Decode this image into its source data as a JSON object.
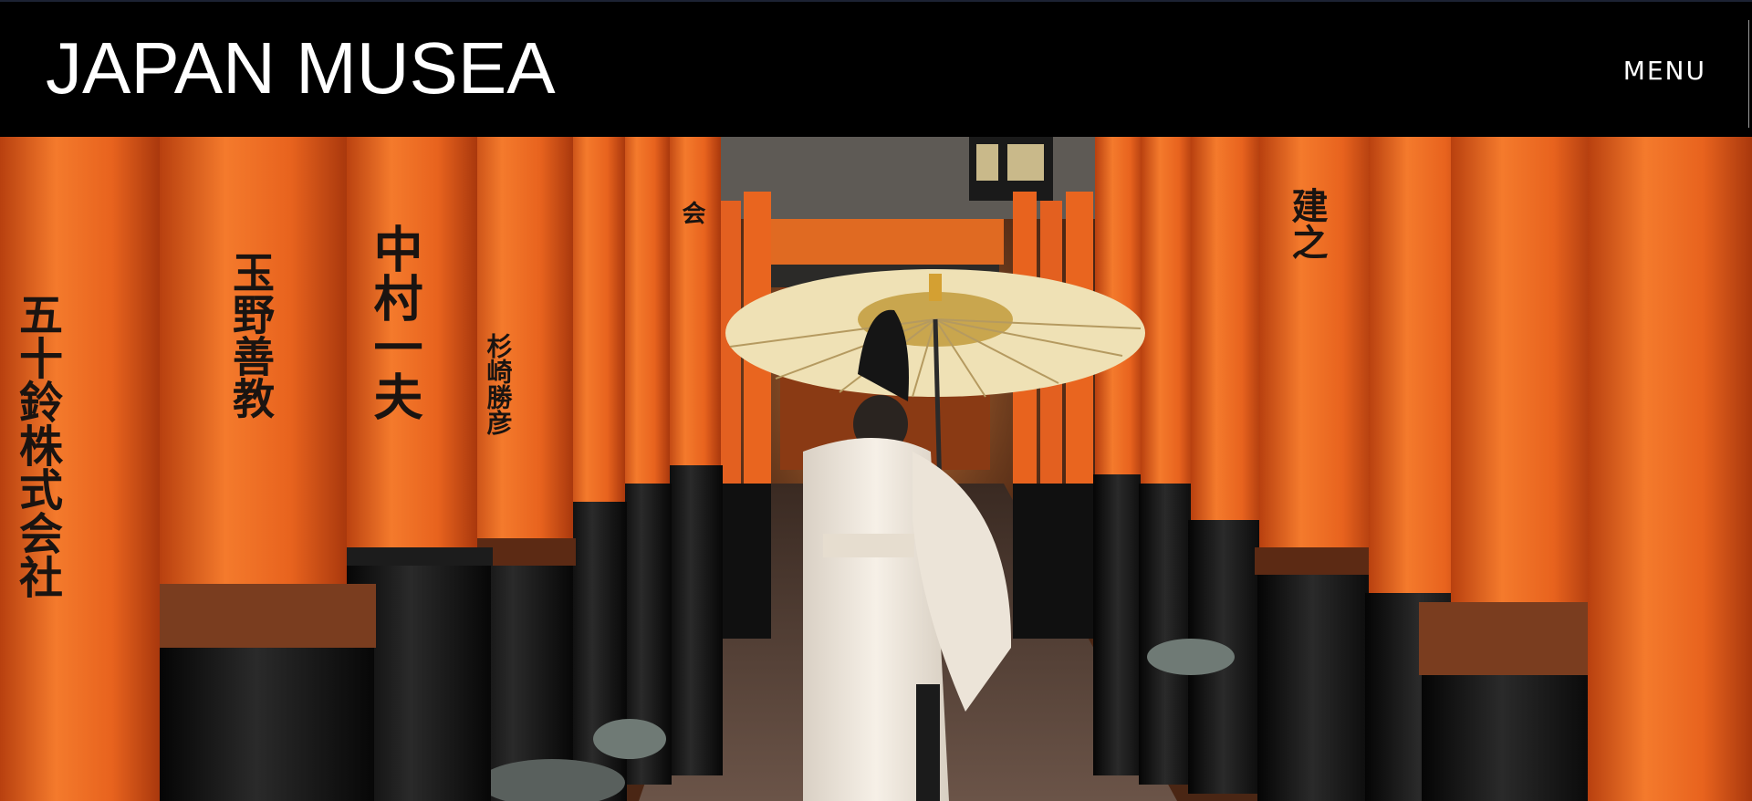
{
  "header": {
    "logo_text": "JAPAN MUSEA",
    "menu_label": "MENU"
  },
  "hero": {
    "scene": "torii-gate-corridor-photo",
    "colors": {
      "pillar_orange": "#e8631e",
      "pillar_dark": "#f07a2a",
      "base_black": "#141414",
      "robe_white": "#f3ece2",
      "umbrella": "#f1e3b8"
    },
    "inscriptions": [
      "五十鈴株式会社",
      "玉野善教",
      "中村一夫",
      "杉崎勝彦",
      "会",
      "建之"
    ]
  }
}
